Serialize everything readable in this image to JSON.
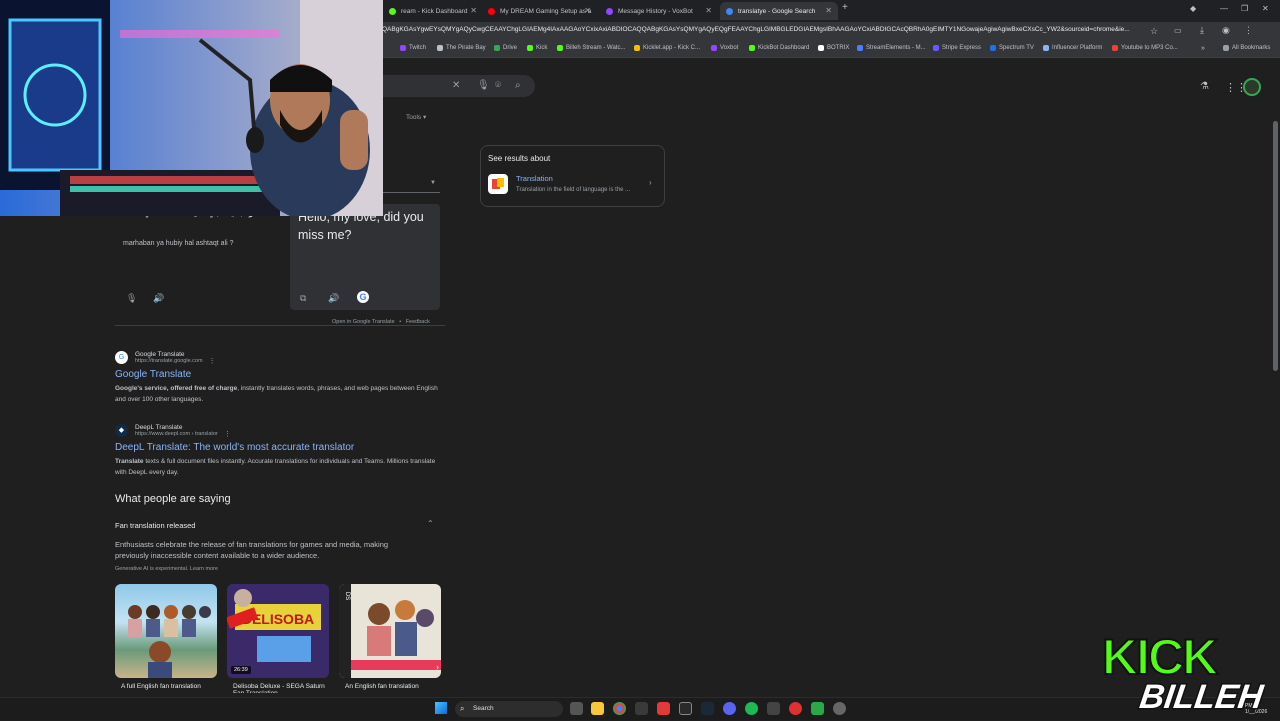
{
  "browser": {
    "tabs": [
      {
        "label": "ream - Kick Dashboard",
        "color": "#53fc18"
      },
      {
        "label": "My DREAM Gaming Setup as a",
        "color": "#ff0000"
      },
      {
        "label": "Message History - VoxBot",
        "color": "#9146ff"
      },
      {
        "label": "translatye - Google Search",
        "color": "#4285f4"
      }
    ],
    "url": "QABgKGAsYgwEYsQMYgAQyCwgCEAAYChgLGIAEMg4IAxAAGAoYCxixAxiABDIOCAQQABgKGAsYsQMYgAQyEQgFEAAYChgLGIMBGLEDGIAEMgsIBhAAGAoYCxiABDIGCAcQBRhA0gEIMTY1NGowajeAgiwAgiwBxeCXsCc_YW2&sourceid=chrome&ie...",
    "bookmarks": [
      {
        "label": "Twitch",
        "color": "#9146ff"
      },
      {
        "label": "The Pirate Bay",
        "color": "#bdc1c6"
      },
      {
        "label": "Drive",
        "color": "#34a853"
      },
      {
        "label": "Kick",
        "color": "#53fc18"
      },
      {
        "label": "Billeh Stream - Watc...",
        "color": "#53fc18"
      },
      {
        "label": "Kicklet.app - Kick C...",
        "color": "#fbbc04"
      },
      {
        "label": "Voxbot",
        "color": "#9146ff"
      },
      {
        "label": "KickBot Dashboard",
        "color": "#53fc18"
      },
      {
        "label": "BOTRIX",
        "color": "#ffffff"
      },
      {
        "label": "StreamElements - M...",
        "color": "#4d7cfe"
      },
      {
        "label": "Stripe Express",
        "color": "#635bff"
      },
      {
        "label": "Spectrum TV",
        "color": "#1a73e8"
      },
      {
        "label": "Influencer Platform",
        "color": "#8ab4f8"
      },
      {
        "label": "Youtube to MP3 Co...",
        "color": "#ea4335"
      }
    ],
    "all_bookmarks": "All Bookmarks"
  },
  "search": {
    "tools_label": "Tools"
  },
  "translate": {
    "source_text": "مرحبا يا حبي هل اشتقت الي ؟",
    "transliteration": "marhaban ya hubiy hal ashtaqt ali ?",
    "target_text": "Hello, my love, did you miss me?",
    "open_link": "Open in Google Translate",
    "separator": "•",
    "feedback": "Feedback"
  },
  "knowledge_panel": {
    "heading": "See results about",
    "title": "Translation",
    "description": "Translation in the field of language is the ..."
  },
  "results": [
    {
      "site": "Google Translate",
      "url": "https://translate.google.com",
      "title": "Google Translate",
      "snippet_bold": "Google's service, offered free of charge",
      "snippet": ", instantly translates words, phrases, and web pages between English and over 100 other languages."
    },
    {
      "site": "DeepL Translate",
      "url": "https://www.deepl.com › translator",
      "title": "DeepL Translate: The world's most accurate translator",
      "snippet_bold": "Translate",
      "snippet": " texts & full document files instantly. Accurate translations for individuals and Teams. Millions translate with DeepL every day."
    }
  ],
  "people_saying": {
    "heading": "What people are saying",
    "topic": "Fan translation released",
    "body": "Enthusiasts celebrate the release of fan translations for games and media, making previously inaccessible content available to a wider audience.",
    "ai_note": "Generative AI is experimental. Learn more",
    "thumbs": [
      {
        "caption": "A full English fan translation"
      },
      {
        "caption": "Delisoba Deluxe - SEGA Saturn Fan Translation",
        "duration": "26:39"
      },
      {
        "caption": "An English fan translation"
      }
    ]
  },
  "taskbar": {
    "search_label": "Search",
    "clock": "PM 1/__/2026"
  },
  "overlay": {
    "logo_top": "KICK",
    "logo_bottom": "BILLEH"
  }
}
